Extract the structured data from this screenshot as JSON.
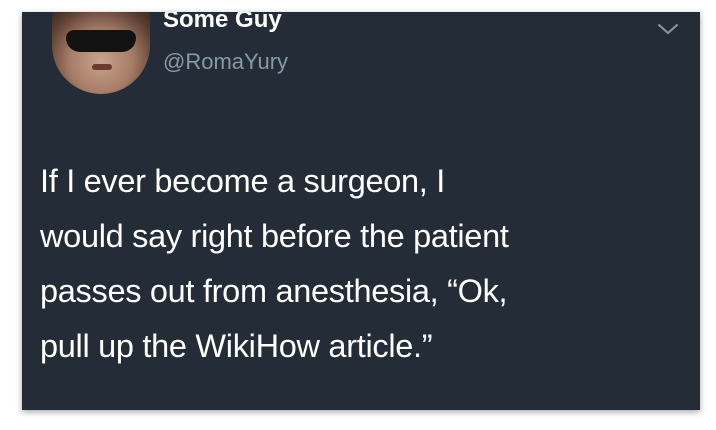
{
  "tweet": {
    "display_name": "Some Guy",
    "handle": "@RomaYury",
    "text_lines": [
      "If I ever become a surgeon, I",
      "would say right before the patient",
      "passes out from anesthesia, “Ok,",
      "pull up the WikiHow article.”"
    ]
  },
  "colors": {
    "card_background": "#242d37",
    "primary_text": "#ffffff",
    "secondary_text": "#8899a6"
  },
  "icons": {
    "menu": "chevron-down-icon",
    "avatar": "profile-photo"
  }
}
